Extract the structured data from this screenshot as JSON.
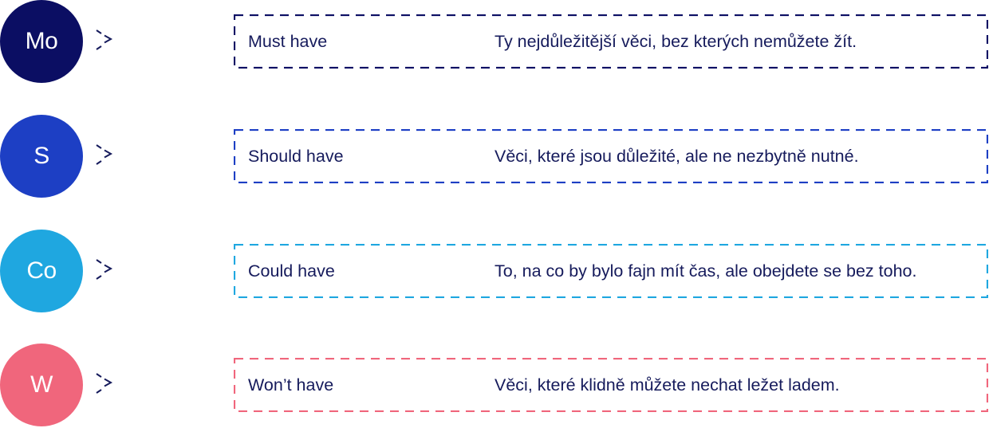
{
  "rows": [
    {
      "abbr": "Mo",
      "label": "Must have",
      "description": "Ty nejdůležitější věci, bez kterých nemůžete žít.",
      "color": "#0b0e63"
    },
    {
      "abbr": "S",
      "label": "Should have",
      "description": "Věci, které jsou důležité, ale ne nezbytně nutné.",
      "color": "#1d3fc4"
    },
    {
      "abbr": "Co",
      "label": "Could have",
      "description": "To, na co by bylo fajn mít čas, ale obejdete se bez toho.",
      "color": "#1fa7e0"
    },
    {
      "abbr": "W",
      "label": "Won’t have",
      "description": "Věci, které klidně můžete nechat ležet ladem.",
      "color": "#f0667c"
    }
  ],
  "arrow_color": "#161b5c",
  "text_color": "#161b5c"
}
